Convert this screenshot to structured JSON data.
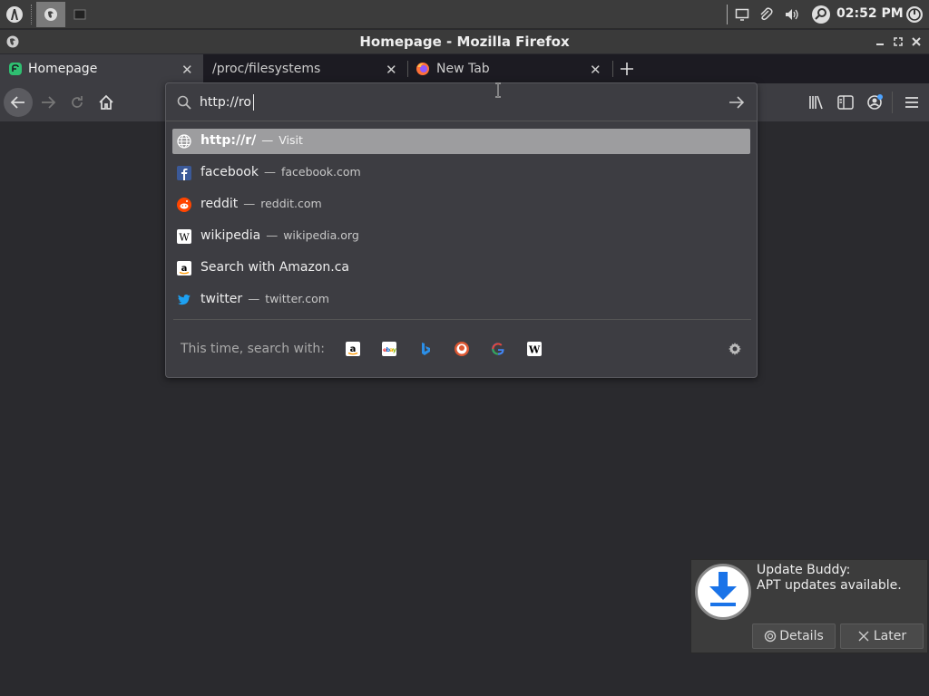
{
  "taskbar": {
    "clock": "02:52 PM",
    "launcher_icon": "app-menu-icon",
    "tray_icons": [
      "screen-icon",
      "paperclip-icon",
      "volume-icon",
      "search-icon",
      "power-icon"
    ]
  },
  "window": {
    "title": "Homepage - Mozilla Firefox"
  },
  "tabs": [
    {
      "label": "Homepage",
      "active": true,
      "icon": "homepage-favicon"
    },
    {
      "label": "/proc/filesystems",
      "active": false,
      "icon": ""
    },
    {
      "label": "New Tab",
      "active": false,
      "icon": "firefox-icon"
    }
  ],
  "urlbar": {
    "value": "http://ro"
  },
  "suggestions": [
    {
      "title_bold": "http://r/",
      "title": "",
      "url": "Visit",
      "icon": "globe-icon",
      "selected": true
    },
    {
      "title_bold": "",
      "title": "facebook",
      "url": "facebook.com",
      "icon": "facebook-icon",
      "selected": false
    },
    {
      "title_bold": "",
      "title": "reddit",
      "url": "reddit.com",
      "icon": "reddit-icon",
      "selected": false
    },
    {
      "title_bold": "",
      "title": "wikipedia",
      "url": "wikipedia.org",
      "icon": "wikipedia-icon",
      "selected": false
    },
    {
      "title_bold": "",
      "title": "Search with Amazon.ca",
      "url": "",
      "icon": "amazon-icon",
      "selected": false
    },
    {
      "title_bold": "",
      "title": "twitter",
      "url": "twitter.com",
      "icon": "twitter-icon",
      "selected": false
    }
  ],
  "search_with": {
    "label": "This time, search with:",
    "engines": [
      "amazon",
      "ebay",
      "bing",
      "duckduckgo",
      "google",
      "wikipedia"
    ]
  },
  "notification": {
    "title": "Update Buddy:",
    "body": "APT updates available.",
    "details_label": "Details",
    "later_label": "Later"
  },
  "colors": {
    "accent": "#0a84ff",
    "toolbar": "#3d3d42",
    "tabbar": "#1c1b22",
    "content": "#2a2a2e"
  }
}
